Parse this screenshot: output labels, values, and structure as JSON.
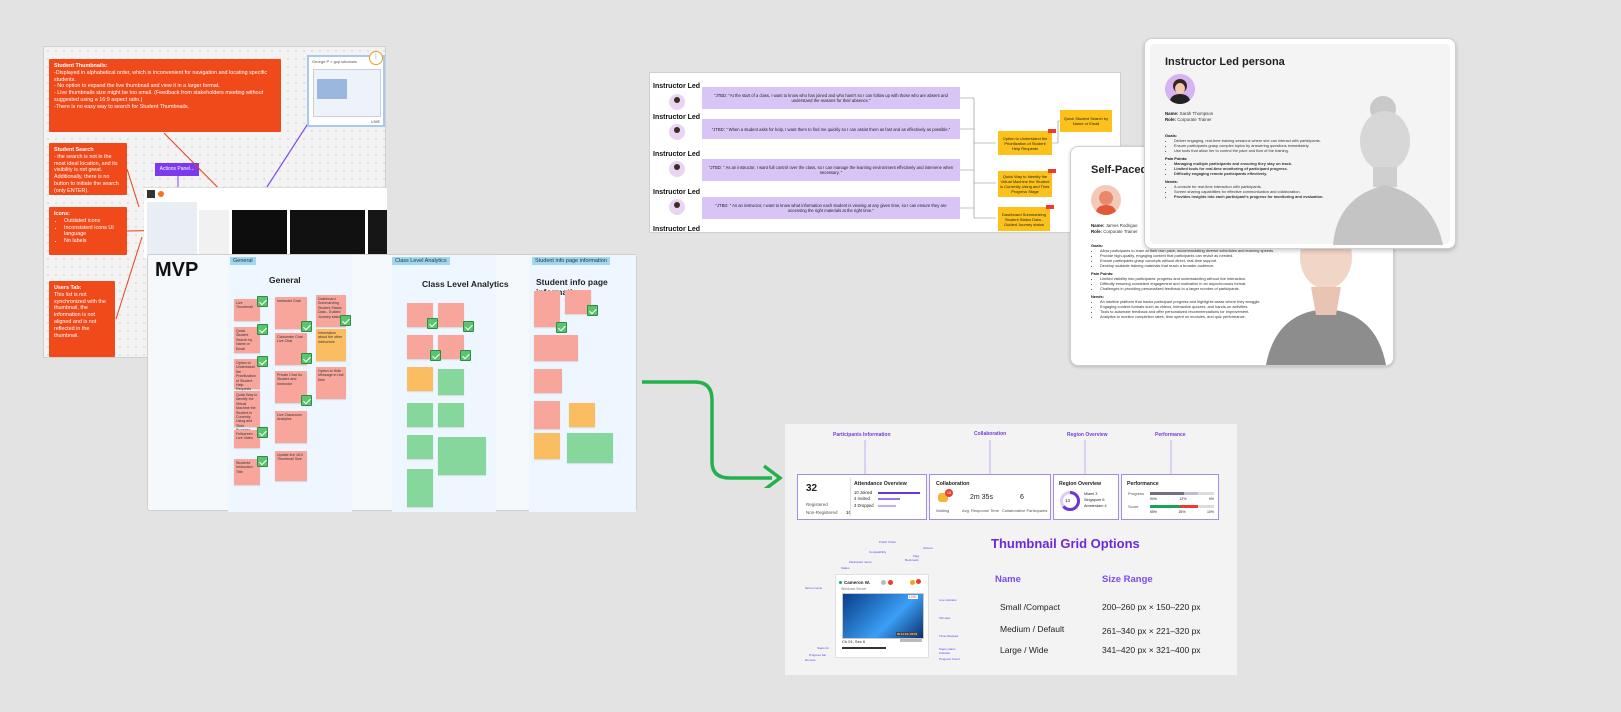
{
  "frame1": {
    "notes": [
      {
        "title": "Student Thumbnails:",
        "lines": [
          "-Displayed in alphabetical order, which is inconvenient for navigation and locating specific students.",
          "- No option to  expand the live thumbnail and view it in a larger format.",
          "- Live thumbnails size might be too small. (Feedback from stakeholders meeting without suggested using a 16:9 aspect ratio.)",
          "-There is no easy way to search for Student Thumbnails."
        ]
      },
      {
        "title": "Student Search",
        "lines": [
          "- the search is not in the most ideal location, and its visibility is not great. Additionally, there is no button to initiate the search (only ENTER)."
        ]
      },
      {
        "title": "Icons:",
        "lines": [
          "Outdated icons",
          "Inconsistent icons UI language",
          "No labels"
        ]
      },
      {
        "title": "Users Tab:",
        "lines": [
          "This list is not synchronized with the thumbnail, the information is not aligned and is not reflected in the thumbnail."
        ]
      }
    ],
    "actions_panel": "Actions Panel...",
    "thumb_name": "George P > gcp-windows",
    "live": "LIVE"
  },
  "mvp": {
    "title": "MVP",
    "tags": [
      "General",
      "Class Level Analytics",
      "Student info page information"
    ],
    "columns": [
      "General",
      "Class Level Analytics",
      "Student info page information"
    ],
    "general_stickies": [
      "Live Thumbnail",
      "Quick Student Search by Name or Email",
      "Option to Understand the Prioritization of Student Help Requests",
      "Quick Way to Identify the Virtual Machine the Student is Currently Using and Their Progress Stage",
      "Fullscreen Live Video",
      "Students' Instruction Title",
      "Instructor Chat",
      "Classmate Chat - Live Chat",
      "Private Chat for Student and Instructor",
      "Live Classroom Analytics",
      "Update live 16:9 Thumbnail Size",
      "Dashboard Summarizing Student Status Data - Guided Journey status",
      "Information about the other instructors",
      "Option to Hide Message in real time"
    ]
  },
  "journey": {
    "label": "Instructor Led",
    "rows": [
      "\"JTBD: \"At the start of a class, I want to know who has joined and who hasn't so I can follow up with those who are absent and understand the reasons for their absence.\"",
      "\"JTBD: \" When a student asks for help,  I want them to find me quickly so I can assist them as fast and as effectively as possible.\"",
      "\"JTBD: \" As an instructor, I want full control over the class, so I can manage the learning environment effectively and intervene when necessary. \"",
      "\"JTBD: \" As an instructor, I want to know what information each student is viewing at any given time, so I can ensure they are accessing the right materials at the right time.\""
    ],
    "solutions": [
      "Option to Understand the Prioritization of Student Help Requests",
      "Quick Way to Identify the Virtual Machine the Student is Currently Using and Their Progress Stage",
      "Dashboard Summarizing Student Status Data - Guided Journey status",
      "Quick Student Search by Name or Email"
    ]
  },
  "persona_instructor": {
    "title": "Instructor Led persona",
    "name_label": "Name:",
    "name": "Sarah Thompson",
    "role_label": "Role:",
    "role": "Corporate Trainer",
    "goals_title": "Goals:",
    "goals": [
      "Deliver engaging, real-time training sessions where she can interact with participants.",
      "Ensure participants grasp complex topics by answering questions immediately.",
      "Use tools that allow her to control the pace and flow of the training."
    ],
    "pain_title": "Pain Points:",
    "pain": [
      "Managing multiple participants and ensuring they stay on track.",
      "Limited tools for real-time monitoring of participant progress.",
      "Difficulty engaging remote participants effectively."
    ],
    "needs_title": "Needs:",
    "needs": [
      "A console for real-time interaction with participants.",
      "Screen sharing capabilities for effective communication and collaboration.",
      "Provides insights into each participant's progress for monitoring and evaluation."
    ]
  },
  "persona_self": {
    "title": "Self-Paced",
    "name_label": "Name:",
    "name": "James Rodrigue",
    "role_label": "Role:",
    "role": "Corporate Trainer",
    "goals_title": "Goals:",
    "goals": [
      "Allow participants to learn at their own pace, accommodating diverse schedules and learning speeds.",
      "Provide high-quality, engaging content that participants can revisit as needed.",
      "Ensure participants grasp concepts without direct, real-time support.",
      "Develop scalable training materials that reach a broader audience."
    ],
    "pain_title": "Pain Points:",
    "pain": [
      "Limited visibility into participants' progress and understanding without live interaction.",
      "Difficulty ensuring consistent engagement and motivation in an asynchronous format.",
      "Challenges in providing personalized feedback to a larger number of participants."
    ],
    "needs_title": "Needs:",
    "needs": [
      "An intuitive platform that tracks participant progress and highlights areas where they struggle.",
      "Engaging content formats such as videos, interactive quizzes, and hands-on activities.",
      "Tools to automate feedback and offer personalized recommendations for improvement.",
      "Analytics to monitor completion rates, time spent on modules, and quiz performance."
    ]
  },
  "dashboard": {
    "section_labels": [
      "Participants Information",
      "Collaboration",
      "Region Overview",
      "Performance"
    ],
    "registered_count": "32",
    "registered_label": "Registered",
    "non_registered_label": "Non-Registered",
    "non_registered_count": "10",
    "attendance_title": "Attendance Overview",
    "attendance": [
      {
        "n": "10",
        "l": "Joined"
      },
      {
        "n": "4",
        "l": "Invited"
      },
      {
        "n": "3",
        "l": "Dropped"
      }
    ],
    "collab_title": "Collaboration",
    "waiting_badge": "18",
    "waiting_label": "Waiting",
    "avg_value": "2m 35s",
    "avg_label": "Avg. Response Time",
    "collab_value": "6",
    "collab_label": "Collaborative Participants",
    "region_title": "Region Overview",
    "region_total": "13",
    "regions": [
      {
        "l": "Miami",
        "n": "3"
      },
      {
        "l": "Singapore",
        "n": "6"
      },
      {
        "l": "Amsterdam",
        "n": "4"
      }
    ],
    "performance_title": "Performance",
    "progress_label": "Progress",
    "progress_vals": [
      "90%",
      "12%",
      "0%"
    ],
    "score_label": "Score",
    "score_vals": [
      "55%",
      "25%",
      "10%"
    ],
    "thumb_title": "Thumbnail Grid Options",
    "name_head": "Name",
    "size_head": "Size Range",
    "sizes": [
      {
        "name": "Small /Compact",
        "range": "200–260 px × 150–220 px"
      },
      {
        "name": "Medium / Default",
        "range": "261–340 px × 221–320 px"
      },
      {
        "name": "Large / Wide",
        "range": "341–420 px × 321–400 px"
      }
    ],
    "thumb_name": "Cameron W.",
    "thumb_sub": "Windows Server",
    "thumb_live": "LIVE",
    "thumb_section": "Ch 01, Sec 6",
    "thumb_timer": "00:12:34 | 00:31",
    "callouts": [
      "Status",
      "Participant name",
      "Compatibility",
      "Public Chats",
      "Bookmark",
      "Flag",
      "Actions",
      "Server name",
      "Live indicator",
      "VM view",
      "Timer Elapsed",
      "Steps status indicator",
      "Progress Count",
      "Steps for",
      "Progress bar",
      "Remote"
    ]
  }
}
